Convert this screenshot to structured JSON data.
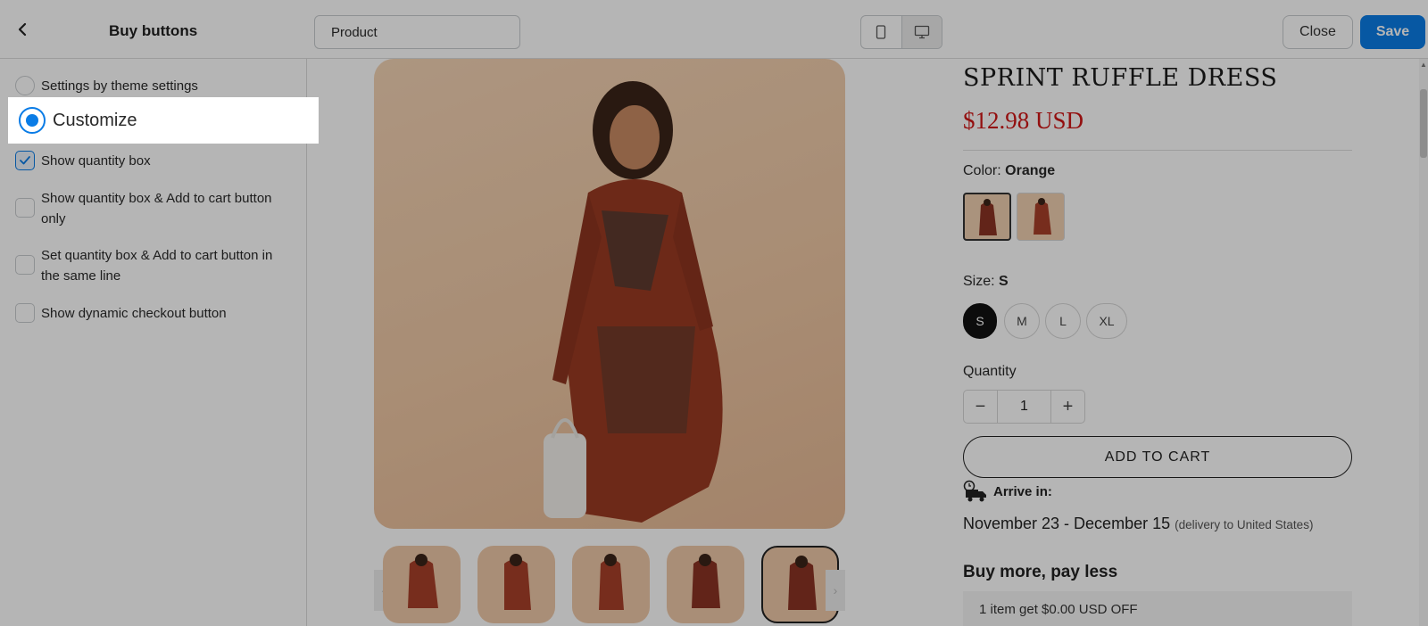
{
  "topbar": {
    "title": "Buy buttons",
    "page_select": "Product",
    "close_label": "Close",
    "save_label": "Save",
    "accent_color": "#0a7ce6"
  },
  "left_panel": {
    "options": [
      {
        "type": "radio",
        "label": "Settings by theme settings",
        "checked": false
      },
      {
        "type": "radio",
        "label": "Customize",
        "checked": true
      },
      {
        "type": "checkbox",
        "label": "Show quantity box",
        "checked": true
      },
      {
        "type": "checkbox",
        "label": "Show quantity box & Add to cart button only",
        "checked": false
      },
      {
        "type": "checkbox",
        "label": "Set quantity box & Add to cart button in the same line",
        "checked": false
      },
      {
        "type": "checkbox",
        "label": "Show dynamic checkout button",
        "checked": false
      }
    ]
  },
  "preview": {
    "product_title": "SPRINT RUFFLE DRESS",
    "price": "$12.98 USD",
    "color_label": "Color:",
    "color_value": "Orange",
    "size_label": "Size:",
    "size_value": "S",
    "sizes": [
      "S",
      "M",
      "L",
      "XL"
    ],
    "quantity_label": "Quantity",
    "quantity_value": "1",
    "minus": "−",
    "plus": "+",
    "add_to_cart": "ADD TO CART",
    "arrive_label": "Arrive in:",
    "delivery_dates": "November 23 - December 15",
    "delivery_note": "(delivery to United States)",
    "buy_more_title": "Buy more, pay less",
    "offer_text": "1 item get $0.00 USD OFF",
    "price_color": "#d01616"
  }
}
